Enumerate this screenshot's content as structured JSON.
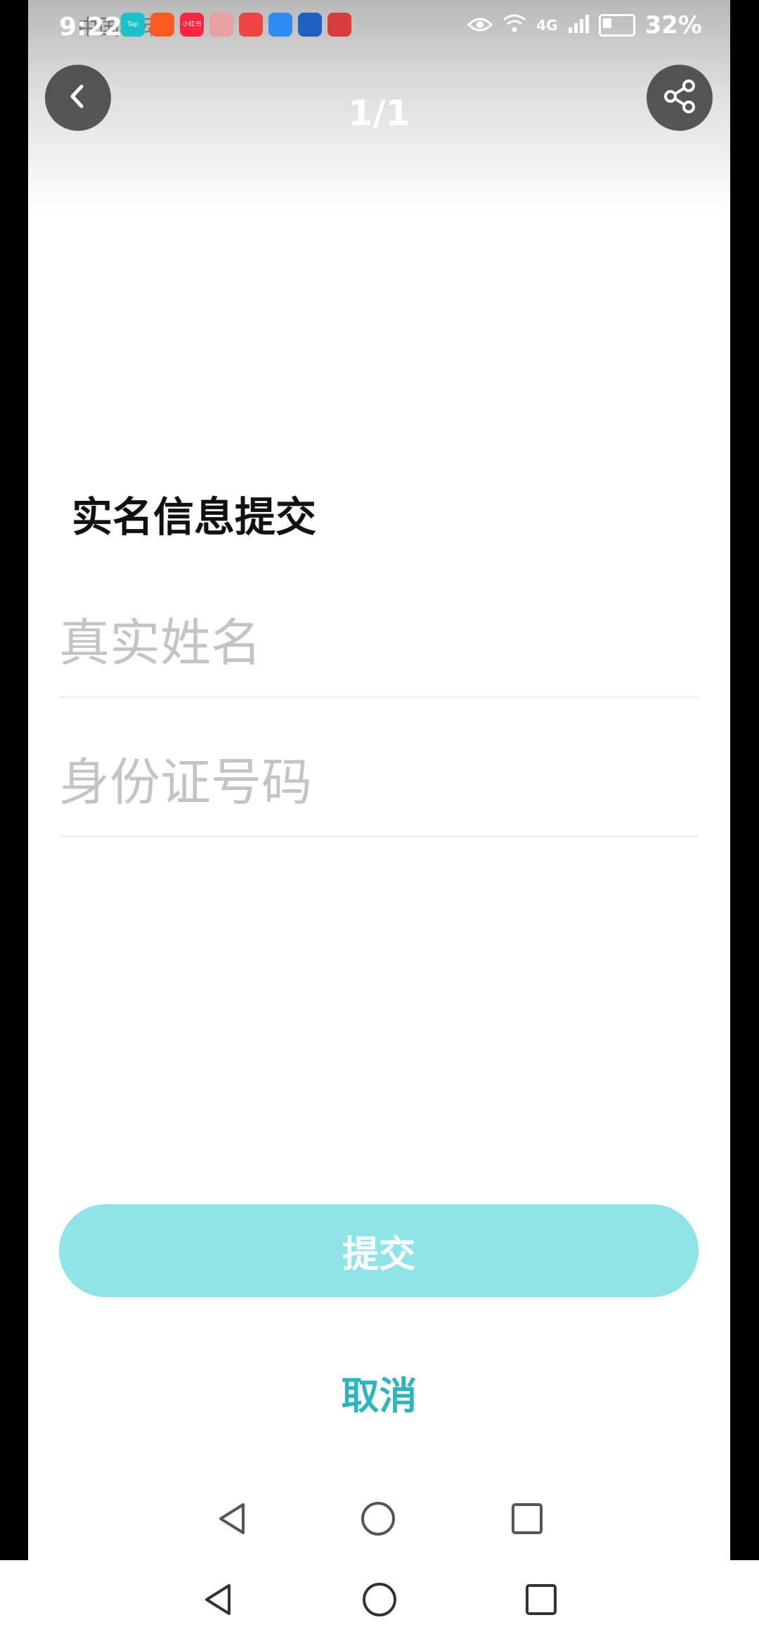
{
  "status_bar": {
    "time": "9:22",
    "carrier": "中国移动",
    "notification_icons": [
      {
        "name": "taptap-icon",
        "label": "Tap",
        "color": "#19c3c8"
      },
      {
        "name": "kuaishou-icon",
        "label": "",
        "color": "#ff5a1f"
      },
      {
        "name": "xiaohongshu-icon",
        "label": "小红书",
        "color": "#ff2442"
      },
      {
        "name": "box-icon",
        "label": "",
        "color": "#e8a0a0"
      },
      {
        "name": "huawei-store-icon",
        "label": "",
        "color": "#ee4444"
      },
      {
        "name": "browser-icon",
        "label": "",
        "color": "#2d8cf0"
      },
      {
        "name": "lightbulb-app-icon",
        "label": "",
        "color": "#1f5fbf"
      },
      {
        "name": "appgallery-icon",
        "label": "",
        "color": "#d93c3c"
      }
    ],
    "network_label": "4G",
    "battery_percent": "32%"
  },
  "header": {
    "page_counter": "1/1"
  },
  "form": {
    "title": "实名信息提交",
    "name_placeholder": "真实姓名",
    "id_placeholder": "身份证号码",
    "submit_label": "提交",
    "cancel_label": "取消"
  },
  "colors": {
    "accent": "#2cb5bf",
    "submit_bg": "#8fe4e8",
    "placeholder": "#c4c4c4"
  }
}
